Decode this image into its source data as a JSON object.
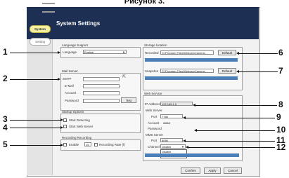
{
  "caption": "Рисунок 3.",
  "window": {
    "title": "System Settings"
  },
  "sidebar": {
    "items": [
      {
        "label": "System"
      },
      {
        "label": "Setting"
      }
    ]
  },
  "language": {
    "group_title": "Language Support",
    "label": "Language",
    "value": "English"
  },
  "mail": {
    "group_title": "Mail Server",
    "smtp_label": "SMTP",
    "email_label": "E-Mail",
    "account_label": "Account",
    "password_label": "Password",
    "test_label": "Test"
  },
  "startup": {
    "group_title": "Startup Options",
    "start_detecting": "Start Detecting",
    "start_web_server": "Start Web Server"
  },
  "recording": {
    "group_title": "Recording Recording",
    "enable_label": "Enable",
    "rate_value": "15",
    "rate_label": "Recording Rate (f)"
  },
  "storage": {
    "group_title": "Storage location",
    "recorded_label": "Recorded",
    "recorded_path": "C:\\Program Files\\WebcamCamera ...",
    "snapshot_label": "Snapshot",
    "snapshot_path": "C:\\Program Files\\WebcamCamera ...",
    "default_label": "Default"
  },
  "web_service": {
    "group_title": "Web Service",
    "ip_label": "IP Address",
    "ip_value": "192.168.1.5",
    "web_server_label": "Web Server",
    "port_label": "Port",
    "port_value": "7780",
    "account_label": "Account",
    "account_value": "aaaa",
    "password_label": "Password",
    "mms_label": "MMS Server",
    "mms_port_label": "Port",
    "mms_port_value": "8080",
    "channel_label": "Channel",
    "channel_value": "Disable",
    "channel_options": [
      "Disable",
      "Enable"
    ]
  },
  "footer": {
    "confirm": "Confirm",
    "apply": "Apply",
    "cancel": "Cancel"
  },
  "callouts": [
    "1",
    "2",
    "3",
    "4",
    "5",
    "6",
    "7",
    "8",
    "9",
    "10",
    "11",
    "12"
  ]
}
